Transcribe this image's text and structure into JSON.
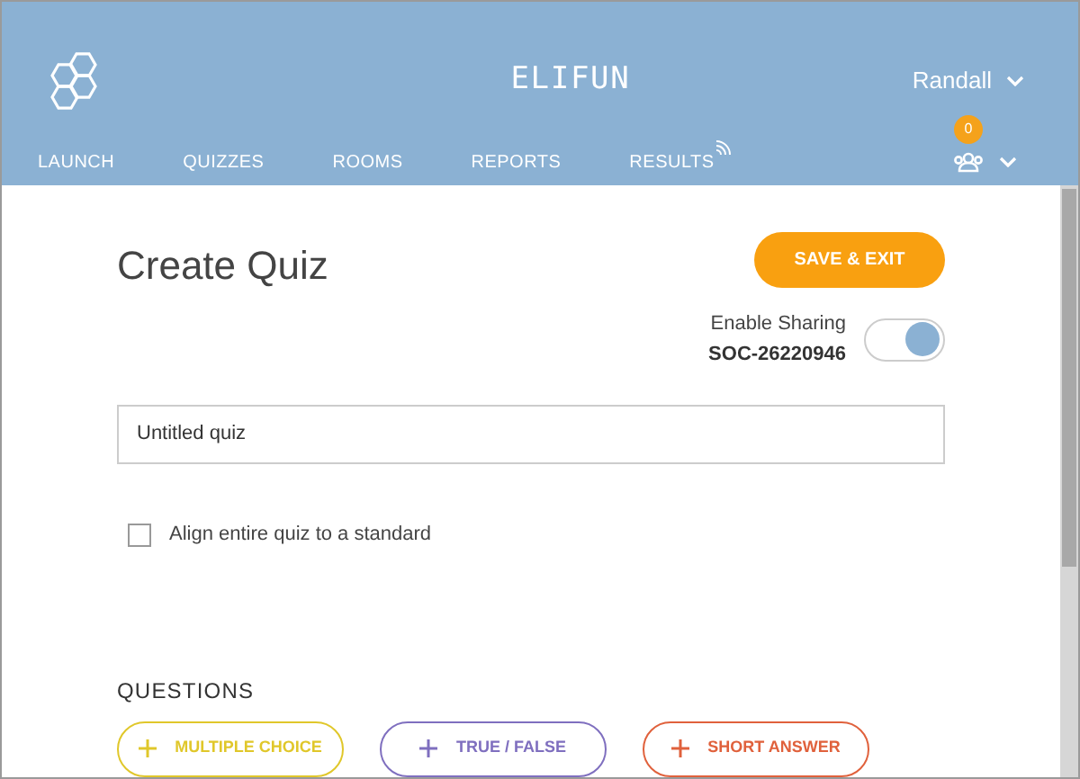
{
  "header": {
    "title": "ELIFUN",
    "user": "Randall",
    "notifications": "0"
  },
  "nav": [
    {
      "label": "LAUNCH",
      "signal": false
    },
    {
      "label": "QUIZZES",
      "signal": false
    },
    {
      "label": "ROOMS",
      "signal": false
    },
    {
      "label": "REPORTS",
      "signal": false
    },
    {
      "label": "RESULTS",
      "signal": true
    }
  ],
  "page_title": "Create Quiz",
  "save_button": "SAVE & EXIT",
  "sharing": {
    "label": "Enable Sharing",
    "code": "SOC-26220946",
    "on": true
  },
  "quiz_name": {
    "value": "Untitled quiz"
  },
  "align": {
    "label": "Align entire quiz to a standard",
    "checked": false
  },
  "questions": {
    "heading": "QUESTIONS",
    "buttons": [
      {
        "label": "MULTIPLE CHOICE",
        "color": "#e0c72a"
      },
      {
        "label": "TRUE / FALSE",
        "color": "#7f6fbf"
      },
      {
        "label": "SHORT ANSWER",
        "color": "#e0613c"
      }
    ]
  }
}
